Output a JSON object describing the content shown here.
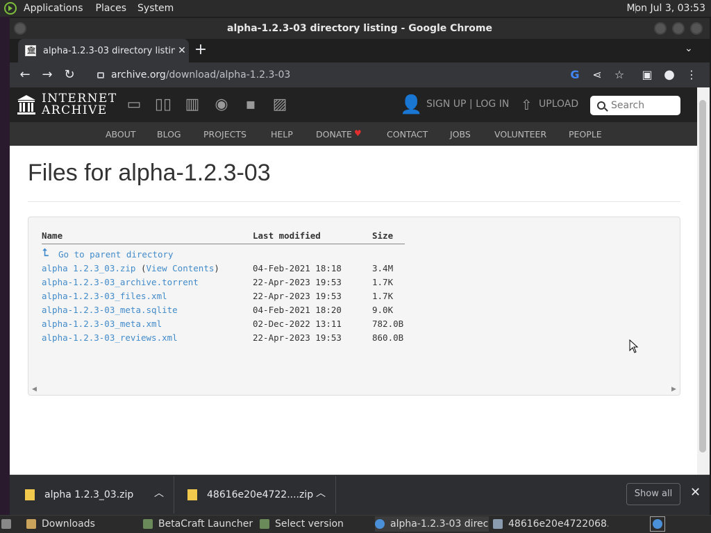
{
  "top_panel": {
    "menus": [
      "Applications",
      "Places",
      "System"
    ],
    "clock": "Mon Jul  3, 03:53"
  },
  "window": {
    "title": "alpha-1.2.3-03 directory listing - Google Chrome"
  },
  "tab": {
    "title": "alpha-1.2.3-03 directory listing",
    "close": "✕"
  },
  "toolbar": {
    "url_host": "archive.org",
    "url_path": "/download/alpha-1.2.3-03"
  },
  "ia_header": {
    "logo_line1": "INTERNET",
    "logo_line2": "ARCHIVE",
    "signup": "SIGN UP | LOG IN",
    "upload": "UPLOAD",
    "search_placeholder": "Search",
    "nav": [
      "ABOUT",
      "BLOG",
      "PROJECTS",
      "HELP",
      "DONATE",
      "CONTACT",
      "JOBS",
      "VOLUNTEER",
      "PEOPLE"
    ]
  },
  "content": {
    "title": "Files for alpha-1.2.3-03",
    "columns": [
      "Name",
      "Last modified",
      "Size"
    ],
    "parent_link": "Go to parent directory",
    "rows": [
      {
        "name": "alpha 1.2.3_03.zip",
        "extra_open": " (",
        "extra_link": "View Contents",
        "extra_close": ")",
        "modified": "04-Feb-2021 18:18",
        "size": "3.4M"
      },
      {
        "name": "alpha-1.2.3-03_archive.torrent",
        "modified": "22-Apr-2023 19:53",
        "size": "1.7K"
      },
      {
        "name": "alpha-1.2.3-03_files.xml",
        "modified": "22-Apr-2023 19:53",
        "size": "1.7K"
      },
      {
        "name": "alpha-1.2.3-03_meta.sqlite",
        "modified": "04-Feb-2021 18:20",
        "size": "9.0K"
      },
      {
        "name": "alpha-1.2.3-03_meta.xml",
        "modified": "02-Dec-2022 13:11",
        "size": "782.0B"
      },
      {
        "name": "alpha-1.2.3-03_reviews.xml",
        "modified": "22-Apr-2023 19:53",
        "size": "860.0B"
      }
    ]
  },
  "downloads": {
    "items": [
      "alpha 1.2.3_03.zip",
      "48616e20e4722....zip"
    ],
    "show_all": "Show all"
  },
  "taskbar": {
    "items": [
      "Downloads",
      "BetaCraft Launcher ...",
      "Select version",
      "alpha-1.2.3-03 direc...",
      "48616e20e4722068..."
    ]
  }
}
